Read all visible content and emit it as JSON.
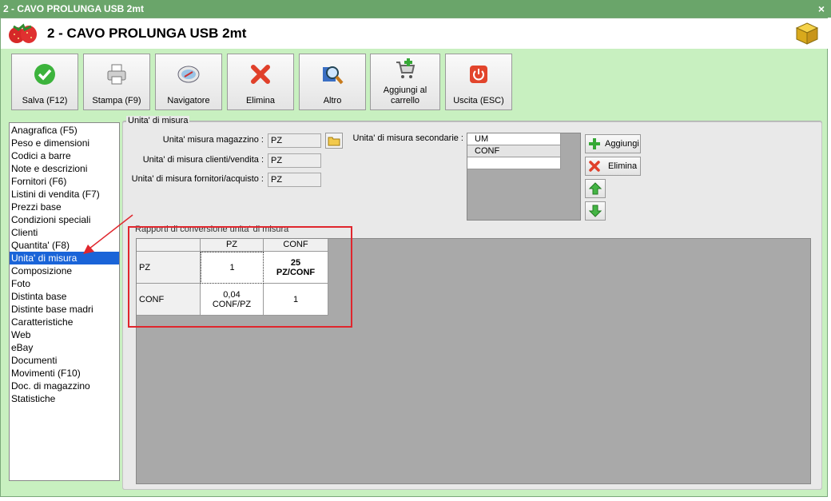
{
  "window": {
    "title": "2 - CAVO PROLUNGA USB 2mt",
    "close_glyph": "×"
  },
  "header": {
    "title": "2 - CAVO PROLUNGA USB 2mt",
    "logo_icon": "strawberry-icon",
    "right_icon": "cube-icon"
  },
  "toolbar": {
    "buttons": [
      {
        "label": "Salva (F12)",
        "icon": "checkmark-icon"
      },
      {
        "label": "Stampa (F9)",
        "icon": "printer-icon"
      },
      {
        "label": "Navigatore",
        "icon": "compass-icon"
      },
      {
        "label": "Elimina",
        "icon": "delete-x-icon"
      },
      {
        "label": "Altro",
        "icon": "magnifier-icon"
      },
      {
        "label": "Aggiungi al carrello",
        "icon": "cart-add-icon"
      },
      {
        "label": "Uscita (ESC)",
        "icon": "power-icon"
      }
    ]
  },
  "sidebar": {
    "items": [
      "Anagrafica (F5)",
      "Peso e dimensioni",
      "Codici a barre",
      "Note e descrizioni",
      "Fornitori (F6)",
      "Listini di vendita (F7)",
      "Prezzi base",
      "Condizioni speciali",
      "Clienti",
      "Quantita' (F8)",
      "Unita' di misura",
      "Composizione",
      "Foto",
      "Distinta base",
      "Distinte base madri",
      "Caratteristiche",
      "Web",
      "eBay",
      "Documenti",
      "Movimenti (F10)",
      "Doc. di magazzino",
      "Statistiche"
    ],
    "selected": "Unita' di misura"
  },
  "panel": {
    "legend": "Unita' di misura",
    "fields": {
      "magazzino": {
        "label": "Unita' misura magazzino :",
        "value": "PZ"
      },
      "clienti": {
        "label": "Unita' di misura clienti/vendita :",
        "value": "PZ"
      },
      "fornitori": {
        "label": "Unita' di misura fornitori/acquisto :",
        "value": "PZ"
      }
    },
    "secondary": {
      "label": "Unita' di misura secondarie :",
      "rows": [
        "UM",
        "CONF",
        ""
      ]
    },
    "buttons": {
      "add": "Aggiungi",
      "delete": "Elimina"
    },
    "conversion": {
      "legend": "Rapporti di conversione unita' di misura",
      "columns": [
        "",
        "PZ",
        "CONF"
      ],
      "rows": [
        {
          "head": "PZ",
          "cells": [
            "1",
            "25\nPZ/CONF"
          ]
        },
        {
          "head": "CONF",
          "cells": [
            "0,04\nCONF/PZ",
            "1"
          ]
        }
      ],
      "cell_a1": "1",
      "cell_a2_value": "25",
      "cell_a2_unit": "PZ/CONF",
      "cell_b1_value": "0,04",
      "cell_b1_unit": "CONF/PZ",
      "cell_b2": "1"
    }
  },
  "colors": {
    "window_bg": "#c8f0c0",
    "titlebar": "#6aa56a",
    "selection": "#1a64d8",
    "highlight_box": "#e0262d"
  }
}
